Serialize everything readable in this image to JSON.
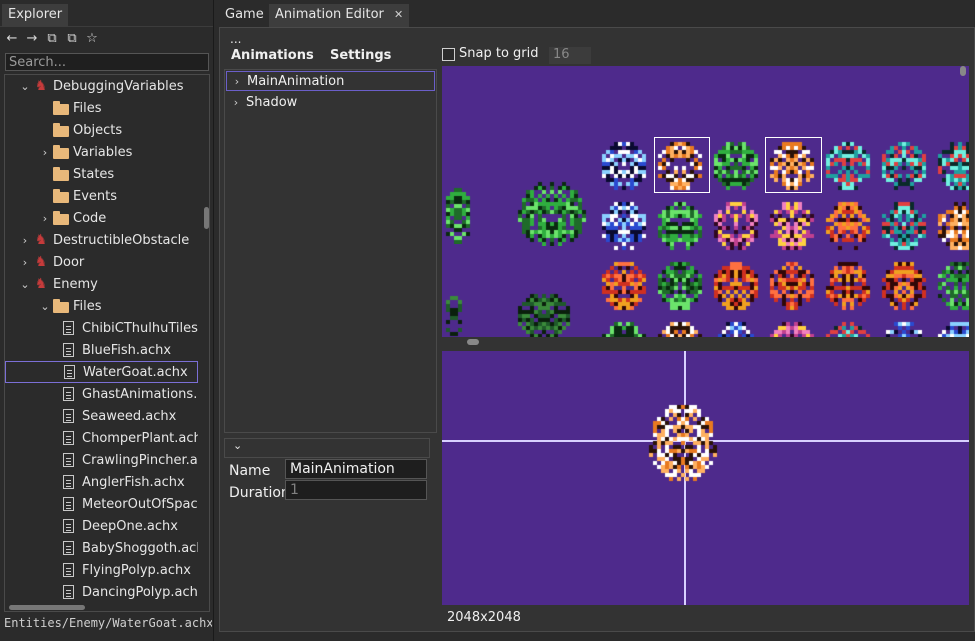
{
  "explorer": {
    "tab_label": "Explorer",
    "search_placeholder": "Search...",
    "path": "Entities/Enemy/WaterGoat.achx",
    "toolbar": {
      "back_icon": "←",
      "forward_icon": "→",
      "collapse_icon": "⧉",
      "expand_icon": "⧉",
      "bookmark_icon": "☆"
    },
    "tree": [
      {
        "label": "DebuggingVariables",
        "kind": "entity",
        "expanded": true
      },
      {
        "label": "Files",
        "kind": "folder"
      },
      {
        "label": "Objects",
        "kind": "folder"
      },
      {
        "label": "Variables",
        "kind": "folder",
        "collapsed": true
      },
      {
        "label": "States",
        "kind": "folder"
      },
      {
        "label": "Events",
        "kind": "folder"
      },
      {
        "label": "Code",
        "kind": "folder",
        "collapsed": true
      },
      {
        "label": "DestructibleObstacle",
        "kind": "entity",
        "collapsed": true
      },
      {
        "label": "Door",
        "kind": "entity",
        "collapsed": true
      },
      {
        "label": "Enemy",
        "kind": "entity",
        "expanded": true
      },
      {
        "label": "Files",
        "kind": "folder",
        "expanded": true
      },
      {
        "label": "ChibiCThulhuTiles.p",
        "kind": "file"
      },
      {
        "label": "BlueFish.achx",
        "kind": "file"
      },
      {
        "label": "WaterGoat.achx",
        "kind": "file",
        "selected": true
      },
      {
        "label": "GhastAnimations.a",
        "kind": "file"
      },
      {
        "label": "Seaweed.achx",
        "kind": "file"
      },
      {
        "label": "ChomperPlant.achx",
        "kind": "file"
      },
      {
        "label": "CrawlingPincher.ac",
        "kind": "file"
      },
      {
        "label": "AnglerFish.achx",
        "kind": "file"
      },
      {
        "label": "MeteorOutOfSpace",
        "kind": "file"
      },
      {
        "label": "DeepOne.achx",
        "kind": "file"
      },
      {
        "label": "BabyShoggoth.ach",
        "kind": "file"
      },
      {
        "label": "FlyingPolyp.achx",
        "kind": "file"
      },
      {
        "label": "DancingPolyp.achx",
        "kind": "file"
      }
    ]
  },
  "editor": {
    "tabs": [
      {
        "label": "Game"
      },
      {
        "label": "Animation Editor",
        "close": "✕"
      }
    ],
    "overflow_menu": "...",
    "menu": {
      "animations": "Animations",
      "settings": "Settings"
    },
    "animations": [
      {
        "label": "MainAnimation",
        "selected": true
      },
      {
        "label": "Shadow"
      }
    ],
    "properties": {
      "toggle": "⌄",
      "name_label": "Name",
      "name_value": "MainAnimation",
      "duration_label": "Duration",
      "duration_value": "1"
    },
    "snap": {
      "label": "Snap to grid",
      "checked": false,
      "value": "16"
    },
    "canvas_size": "2048x2048",
    "colors": {
      "canvas_bg": "#4e2a8c",
      "accent": "#6b5fc9"
    }
  }
}
